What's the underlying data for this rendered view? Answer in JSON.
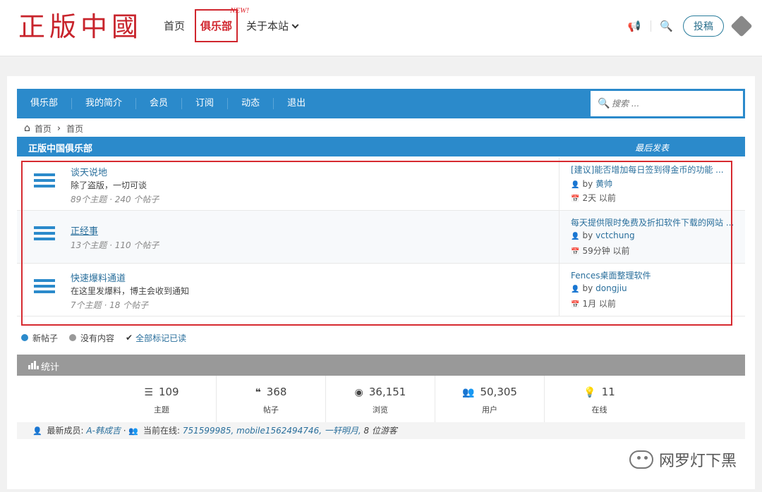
{
  "header": {
    "logo_text": "正版中國",
    "nav": {
      "home": "首页",
      "club": "俱乐部",
      "new_badge": "NEW!",
      "about": "关于本站"
    },
    "submit_label": "投稿",
    "megaphone_glyph": "📢",
    "search_glyph": "🔍"
  },
  "subnav": {
    "items": [
      "俱乐部",
      "我的简介",
      "会员",
      "订阅",
      "动态",
      "退出"
    ],
    "search_placeholder": "搜索 ..."
  },
  "breadcrumb": [
    "首页",
    "首页"
  ],
  "category": {
    "title": "正版中国俱乐部",
    "last_post_label": "最后发表"
  },
  "forums": [
    {
      "title": "谈天说地",
      "desc": "除了盗版，一切可谈",
      "stats": "89个主题 · 240 个帖子",
      "last_title": "[建议]能否增加每日签到得金币的功能 ...",
      "last_by": "by",
      "last_author": "黄帅",
      "last_time": "2天 以前"
    },
    {
      "title": "正经事",
      "desc": "",
      "stats": "13个主题 · 110 个帖子",
      "last_title": "每天提供限时免费及折扣软件下载的网站 ...",
      "last_by": "by",
      "last_author": "vctchung",
      "last_time": "59分钟 以前"
    },
    {
      "title": "快速爆料通道",
      "desc": "在这里发爆料，博主会收到通知",
      "stats": "7个主题 · 18 个帖子",
      "last_title": "Fences桌面整理软件",
      "last_by": "by",
      "last_author": "dongjiu",
      "last_time": "1月 以前"
    }
  ],
  "legend": {
    "new_posts": "新帖子",
    "no_content": "没有内容",
    "mark_all_read": "全部标记已读",
    "colors": {
      "new": "#2b8acb",
      "none": "#999999"
    }
  },
  "stats": {
    "title": "统计",
    "items": [
      {
        "icon": "list-icon",
        "glyph": "☰",
        "value": "109",
        "label": "主题"
      },
      {
        "icon": "quote-icon",
        "glyph": "❝",
        "value": "368",
        "label": "帖子"
      },
      {
        "icon": "eye-icon",
        "glyph": "◉",
        "value": "36,151",
        "label": "浏览"
      },
      {
        "icon": "users-icon",
        "glyph": "👥",
        "value": "50,305",
        "label": "用户"
      },
      {
        "icon": "lightbulb-icon",
        "glyph": "💡",
        "value": "11",
        "label": "在线"
      }
    ],
    "newest_member_label": "最新成员:",
    "newest_member": "A-韩成吉",
    "online_label": "当前在线:",
    "online_users": "751599985, mobile1562494746, 一轩明月,",
    "guests": "8 位游客"
  },
  "watermark": "网罗灯下黑",
  "colors": {
    "accent": "#2b8acb",
    "brand_red": "#c8242c",
    "stats_bar": "#999999"
  }
}
